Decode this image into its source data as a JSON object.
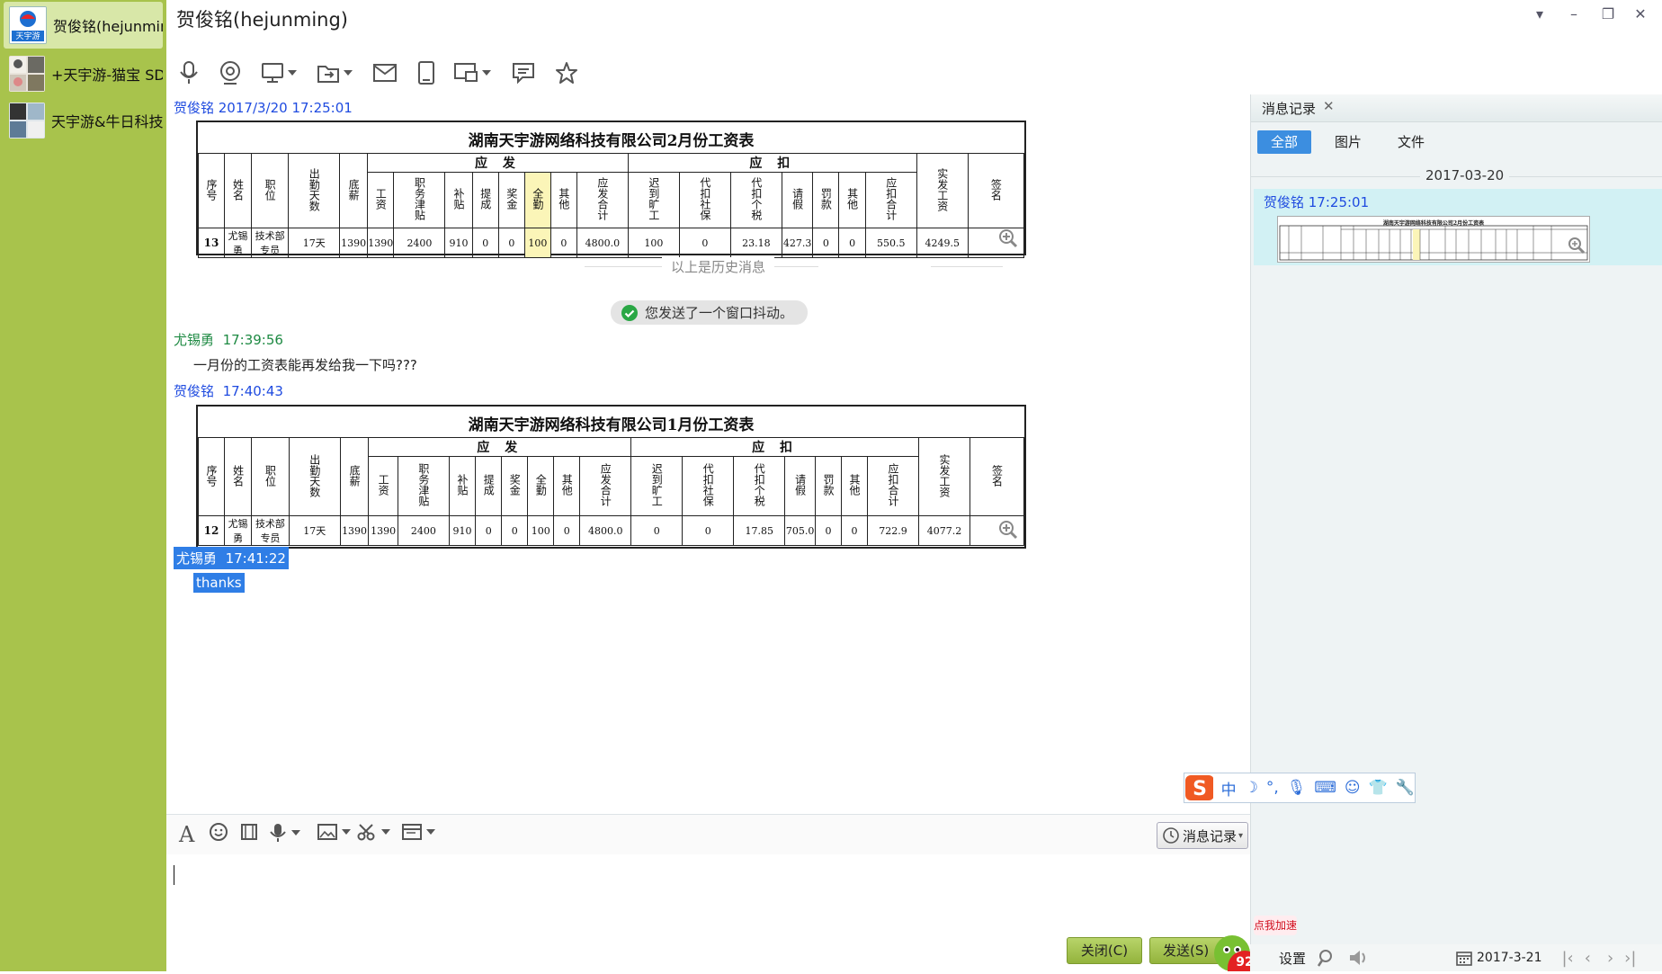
{
  "window": {
    "title": "贺俊铭(hejunming)"
  },
  "sidebar": {
    "contacts": [
      {
        "name": "贺俊铭(hejunming",
        "active": true
      },
      {
        "name": "+天宇游-猫宝 SDK",
        "active": false
      },
      {
        "name": "天宇游&牛日科技",
        "active": false
      }
    ]
  },
  "messages": {
    "m1": {
      "sender_time": "贺俊铭 2017/3/20 17:25:01"
    },
    "history_note": "以上是历史消息",
    "shake_note": "您发送了一个窗口抖动。",
    "m2": {
      "sender": "尤锡勇",
      "time": "17:39:56",
      "text": "一月份的工资表能再发给我一下吗???"
    },
    "m3": {
      "sender": "贺俊铭",
      "time": "17:40:43"
    },
    "m4": {
      "sender": "尤锡勇",
      "time": "17:41:22",
      "text": "thanks"
    }
  },
  "payslip_feb": {
    "title": "湖南天宇游网络科技有限公司2月份工资表",
    "group_pay": "应 发",
    "group_deduct": "应 扣",
    "headers": [
      "序号",
      "姓名",
      "职位",
      "出勤天数",
      "底薪",
      "工资",
      "职务津贴",
      "补贴",
      "提成",
      "奖金",
      "全勤",
      "其他",
      "应发合计",
      "迟到旷工",
      "代扣社保",
      "代扣个税",
      "请假",
      "罚款",
      "其他",
      "应扣合计",
      "实发工资",
      "签名"
    ],
    "row": [
      "13",
      "尤锡勇",
      "技术部专员",
      "17天",
      "1390",
      "1390",
      "2400",
      "910",
      "0",
      "0",
      "100",
      "0",
      "4800.0",
      "100",
      "0",
      "23.18",
      "427.3",
      "0",
      "0",
      "550.5",
      "4249.5",
      ""
    ]
  },
  "payslip_jan": {
    "title": "湖南天宇游网络科技有限公司1月份工资表",
    "group_pay": "应 发",
    "group_deduct": "应 扣",
    "headers": [
      "序号",
      "姓名",
      "职位",
      "出勤天数",
      "底薪",
      "工资",
      "职务津贴",
      "补贴",
      "提成",
      "奖金",
      "全勤",
      "其他",
      "应发合计",
      "迟到旷工",
      "代扣社保",
      "代扣个税",
      "请假",
      "罚款",
      "其他",
      "应扣合计",
      "实发工资",
      "签名"
    ],
    "row": [
      "12",
      "尤锡勇",
      "技术部专员",
      "17天",
      "1390",
      "1390",
      "2400",
      "910",
      "0",
      "0",
      "100",
      "0",
      "4800.0",
      "0",
      "0",
      "17.85",
      "705.0",
      "0",
      "0",
      "722.9",
      "4077.2",
      ""
    ]
  },
  "right_panel": {
    "title": "消息记录",
    "tabs": [
      "全部",
      "图片",
      "文件"
    ],
    "date": "2017-03-20",
    "entry_header": "贺俊铭 17:25:01",
    "thumb_title": "湖南天宇游网络科技有限公司2月份工资表"
  },
  "input": {
    "history_button": "消息记录",
    "ime_chars": [
      "中",
      "☽",
      "°,"
    ]
  },
  "buttons": {
    "close": "关闭(C)",
    "send": "发送(S)",
    "speed_badge": "点我加速",
    "score": "92"
  },
  "status_bar": {
    "settings": "设置",
    "date": "2017-3-21"
  },
  "colors": {
    "sidebar_bg": "#a8c34c",
    "me_name": "#1f4be0",
    "them_name": "#1e8a43",
    "selection": "#2f7ee6",
    "button_green": "#a3c250",
    "tab_active": "#3c8ee0"
  }
}
